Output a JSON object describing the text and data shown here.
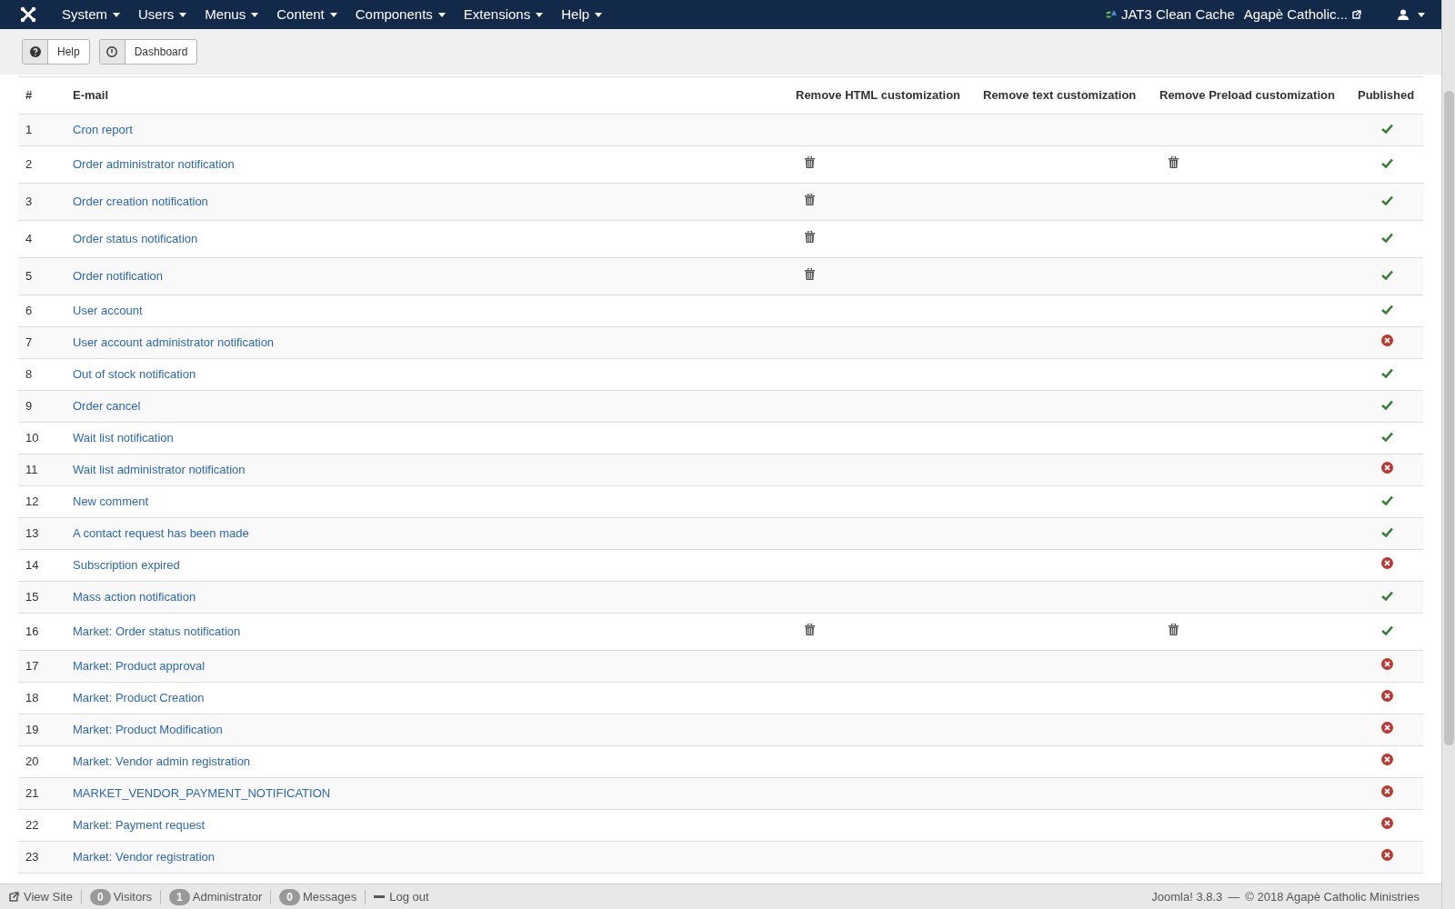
{
  "menu": [
    {
      "label": "System"
    },
    {
      "label": "Users"
    },
    {
      "label": "Menus"
    },
    {
      "label": "Content"
    },
    {
      "label": "Components"
    },
    {
      "label": "Extensions"
    },
    {
      "label": "Help"
    }
  ],
  "header_right": {
    "cache": "JAT3 Clean Cache",
    "site": "Agapè Catholic..."
  },
  "toolbar": [
    {
      "kind": "help",
      "label": "Help"
    },
    {
      "kind": "dashboard",
      "label": "Dashboard"
    }
  ],
  "table": {
    "columns": [
      "#",
      "E-mail",
      "Remove HTML customization",
      "Remove text customization",
      "Remove Preload customization",
      "Published"
    ],
    "rows": [
      {
        "num": "1",
        "email": "Cron report",
        "remove_html": false,
        "remove_text": false,
        "remove_preload": false,
        "published": true
      },
      {
        "num": "2",
        "email": "Order administrator notification",
        "remove_html": true,
        "remove_text": false,
        "remove_preload": true,
        "published": true
      },
      {
        "num": "3",
        "email": "Order creation notification",
        "remove_html": true,
        "remove_text": false,
        "remove_preload": false,
        "published": true
      },
      {
        "num": "4",
        "email": "Order status notification",
        "remove_html": true,
        "remove_text": false,
        "remove_preload": false,
        "published": true
      },
      {
        "num": "5",
        "email": "Order notification",
        "remove_html": true,
        "remove_text": false,
        "remove_preload": false,
        "published": true
      },
      {
        "num": "6",
        "email": "User account",
        "remove_html": false,
        "remove_text": false,
        "remove_preload": false,
        "published": true
      },
      {
        "num": "7",
        "email": "User account administrator notification",
        "remove_html": false,
        "remove_text": false,
        "remove_preload": false,
        "published": false
      },
      {
        "num": "8",
        "email": "Out of stock notification",
        "remove_html": false,
        "remove_text": false,
        "remove_preload": false,
        "published": true
      },
      {
        "num": "9",
        "email": "Order cancel",
        "remove_html": false,
        "remove_text": false,
        "remove_preload": false,
        "published": true
      },
      {
        "num": "10",
        "email": "Wait list notification",
        "remove_html": false,
        "remove_text": false,
        "remove_preload": false,
        "published": true
      },
      {
        "num": "11",
        "email": "Wait list administrator notification",
        "remove_html": false,
        "remove_text": false,
        "remove_preload": false,
        "published": false
      },
      {
        "num": "12",
        "email": "New comment",
        "remove_html": false,
        "remove_text": false,
        "remove_preload": false,
        "published": true
      },
      {
        "num": "13",
        "email": "A contact request has been made",
        "remove_html": false,
        "remove_text": false,
        "remove_preload": false,
        "published": true
      },
      {
        "num": "14",
        "email": "Subscription expired",
        "remove_html": false,
        "remove_text": false,
        "remove_preload": false,
        "published": false
      },
      {
        "num": "15",
        "email": "Mass action notification",
        "remove_html": false,
        "remove_text": false,
        "remove_preload": false,
        "published": true
      },
      {
        "num": "16",
        "email": "Market: Order status notification",
        "remove_html": true,
        "remove_text": false,
        "remove_preload": true,
        "published": true
      },
      {
        "num": "17",
        "email": "Market: Product approval",
        "remove_html": false,
        "remove_text": false,
        "remove_preload": false,
        "published": false
      },
      {
        "num": "18",
        "email": "Market: Product Creation",
        "remove_html": false,
        "remove_text": false,
        "remove_preload": false,
        "published": false
      },
      {
        "num": "19",
        "email": "Market: Product Modification",
        "remove_html": false,
        "remove_text": false,
        "remove_preload": false,
        "published": false
      },
      {
        "num": "20",
        "email": "Market: Vendor admin registration",
        "remove_html": false,
        "remove_text": false,
        "remove_preload": false,
        "published": false
      },
      {
        "num": "21",
        "email": "MARKET_VENDOR_PAYMENT_NOTIFICATION",
        "remove_html": false,
        "remove_text": false,
        "remove_preload": false,
        "published": false
      },
      {
        "num": "22",
        "email": "Market: Payment request",
        "remove_html": false,
        "remove_text": false,
        "remove_preload": false,
        "published": false
      },
      {
        "num": "23",
        "email": "Market: Vendor registration",
        "remove_html": false,
        "remove_text": false,
        "remove_preload": false,
        "published": false
      }
    ]
  },
  "status_bar": {
    "view_site": "View Site",
    "items": [
      {
        "count": "0",
        "label": "Visitors"
      },
      {
        "count": "1",
        "label": "Administrator"
      },
      {
        "count": "0",
        "label": "Messages"
      }
    ],
    "logout": "Log out",
    "version": "Joomla! 3.8.3",
    "separator": "—",
    "copyright": "© 2018 Agapè Catholic Ministries"
  }
}
